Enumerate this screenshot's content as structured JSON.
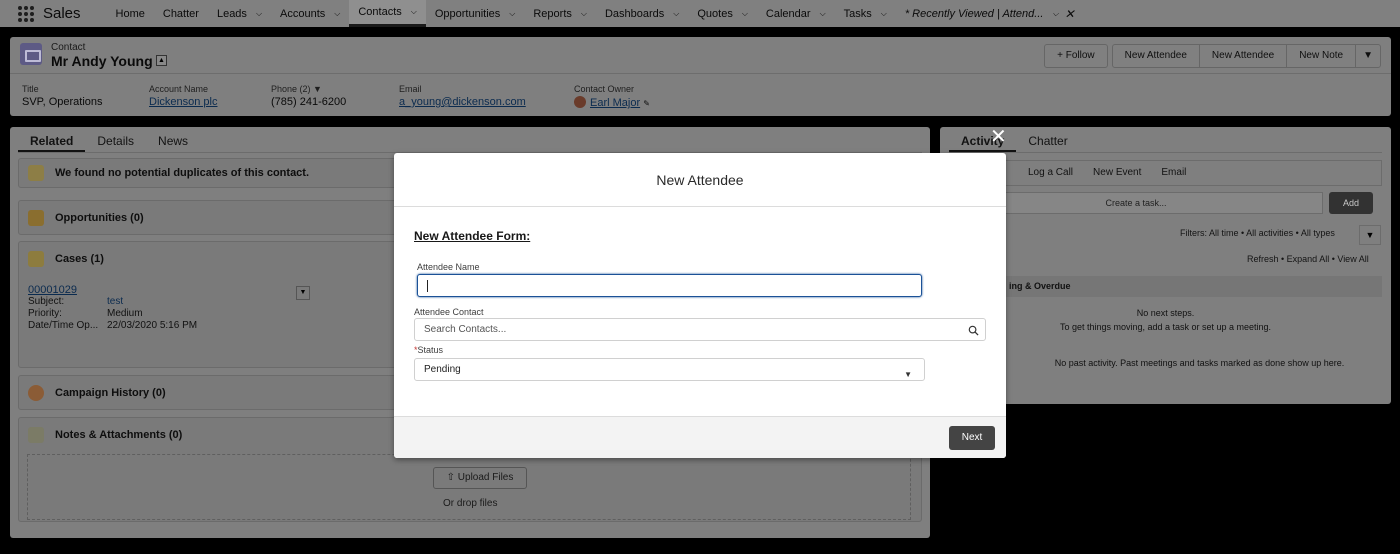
{
  "nav": {
    "app_name": "Sales",
    "items": [
      {
        "label": "Home",
        "chevron": false
      },
      {
        "label": "Chatter",
        "chevron": false
      },
      {
        "label": "Leads",
        "chevron": true
      },
      {
        "label": "Accounts",
        "chevron": true
      },
      {
        "label": "Contacts",
        "chevron": true,
        "active": true
      },
      {
        "label": "Opportunities",
        "chevron": true
      },
      {
        "label": "Reports",
        "chevron": true
      },
      {
        "label": "Dashboards",
        "chevron": true
      },
      {
        "label": "Quotes",
        "chevron": true
      },
      {
        "label": "Calendar",
        "chevron": true
      },
      {
        "label": "Tasks",
        "chevron": true
      }
    ],
    "recent_tab": "* Recently Viewed | Attend..."
  },
  "record": {
    "type_label": "Contact",
    "name": "Mr Andy Young",
    "actions": {
      "follow": "Follow",
      "new_attendee_1": "New Attendee",
      "new_attendee_2": "New Attendee",
      "new_note": "New Note"
    },
    "fields": {
      "title_label": "Title",
      "title_value": "SVP, Operations",
      "account_label": "Account Name",
      "account_value": "Dickenson plc",
      "phone_label": "Phone (2)",
      "phone_value": "(785) 241-6200",
      "email_label": "Email",
      "email_value": "a_young@dickenson.com",
      "owner_label": "Contact Owner",
      "owner_value": "Earl Major"
    }
  },
  "left": {
    "tabs": [
      "Related",
      "Details",
      "News"
    ],
    "duplicates": "We found no potential duplicates of this contact.",
    "opportunities": "Opportunities (0)",
    "cases": "Cases (1)",
    "case": {
      "number": "00001029",
      "subject_label": "Subject:",
      "subject_value": "test",
      "priority_label": "Priority:",
      "priority_value": "Medium",
      "date_label": "Date/Time Op...",
      "date_value": "22/03/2020 5:16 PM"
    },
    "campaign": "Campaign History (0)",
    "notes": "Notes & Attachments (0)",
    "upload": "Upload Files",
    "drop": "Or drop files"
  },
  "right": {
    "tabs": [
      "Activity",
      "Chatter"
    ],
    "publisher": [
      "Log a Call",
      "New Event",
      "Email"
    ],
    "task_placeholder": "Create a task...",
    "add": "Add",
    "filters": "Filters: All time • All activities • All types",
    "refresh": "Refresh • Expand All • View All",
    "upcoming": "ing & Overdue",
    "no_next_1": "No next steps.",
    "no_next_2": "To get things moving, add a task or set up a meeting.",
    "no_past": "No past activity. Past meetings and tasks marked as done show up here."
  },
  "modal": {
    "title": "New Attendee",
    "form_title": "New Attendee Form:",
    "name_label": "Attendee Name",
    "name_value": "",
    "contact_label": "Attendee Contact",
    "contact_placeholder": "Search Contacts...",
    "status_required": "*",
    "status_label": "Status",
    "status_value": "Pending",
    "next": "Next"
  },
  "colors": {
    "modal_focus": "#1b5297",
    "next_button": "#444444",
    "required": "#c23934"
  }
}
